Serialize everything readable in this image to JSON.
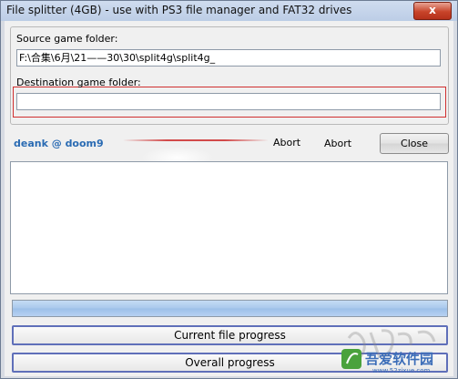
{
  "window": {
    "title": "File splitter (4GB) - use with PS3 file manager and FAT32 drives",
    "close_glyph": "x"
  },
  "source": {
    "label": "Source game folder:",
    "value": "F:\\合集\\6月\\21——30\\30\\split4g\\split4g_"
  },
  "destination": {
    "label": "Destination game folder:",
    "value": ""
  },
  "author": "deank @ doom9",
  "buttons": {
    "abort_1": "Abort",
    "abort_2": "Abort",
    "close": "Close",
    "current_file_progress": "Current file progress",
    "overall_progress": "Overall progress"
  },
  "progress": {
    "fill_fraction": 1.0
  },
  "watermark": {
    "text": "吾爱软件园",
    "url": "www.52zixue.com"
  },
  "colors": {
    "accent": "#2a6bb3",
    "highlight_red": "#d03030",
    "progress_border": "#5f6fb9"
  }
}
